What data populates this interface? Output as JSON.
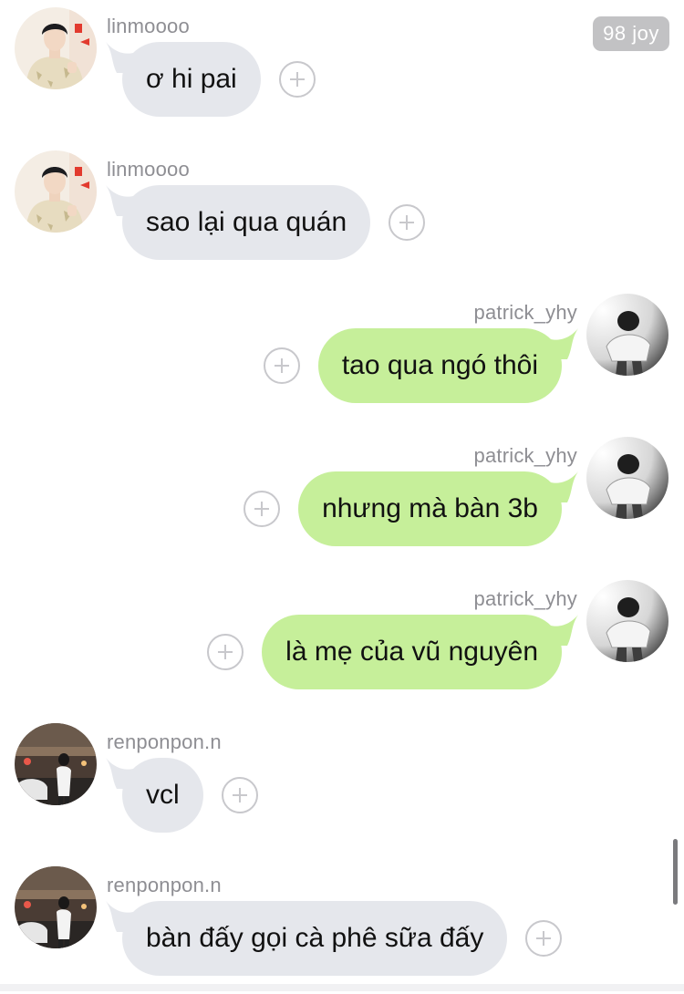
{
  "badge": {
    "text": "98 joy"
  },
  "messages": [
    {
      "side": "left",
      "username": "linmoooo",
      "text": "ơ hi pai",
      "avatar": "avatar-linmoooo-icon"
    },
    {
      "side": "left",
      "username": "linmoooo",
      "text": "sao lại qua quán",
      "avatar": "avatar-linmoooo-icon"
    },
    {
      "side": "right",
      "username": "patrick_yhy",
      "text": "tao qua ngó thôi",
      "avatar": "avatar-patrick-icon"
    },
    {
      "side": "right",
      "username": "patrick_yhy",
      "text": "nhưng mà bàn 3b",
      "avatar": "avatar-patrick-icon"
    },
    {
      "side": "right",
      "username": "patrick_yhy",
      "text": "là mẹ của vũ nguyên",
      "avatar": "avatar-patrick-icon"
    },
    {
      "side": "left",
      "username": "renponpon.n",
      "text": "vcl",
      "avatar": "avatar-renponpon-icon"
    },
    {
      "side": "left",
      "username": "renponpon.n",
      "text": "bàn đấy gọi cà phê sữa đấy",
      "avatar": "avatar-renponpon-icon"
    }
  ],
  "icons": {
    "reaction": "plus-circle-icon"
  },
  "colors": {
    "incoming_bubble": "#e5e7ec",
    "outgoing_bubble": "#c6ef9a",
    "username": "#8e8e93",
    "badge_bg": "#c2c2c4"
  }
}
